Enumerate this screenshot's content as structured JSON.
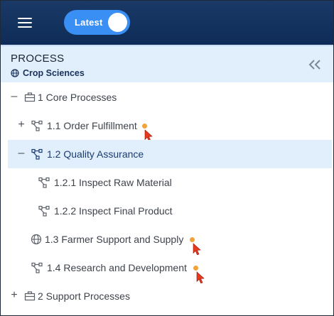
{
  "toolbar": {
    "menu_icon": "hamburger-menu-icon",
    "toggle_label": "Latest",
    "toggle_state": "on"
  },
  "panel": {
    "title": "PROCESS",
    "subtitle": "Crop Sciences",
    "subtitle_icon": "globe-icon",
    "collapse_icon": "double-chevron-left-icon"
  },
  "tree": {
    "items": [
      {
        "label": "1 Core Processes",
        "expander": "–",
        "icon": "briefcase-icon"
      },
      {
        "label": "1.1 Order Fulfillment",
        "expander": "+",
        "icon": "process-flow-icon",
        "indicator": true
      },
      {
        "label": "1.2 Quality Assurance",
        "expander": "–",
        "icon": "process-flow-icon",
        "selected": true
      },
      {
        "label": "1.2.1 Inspect Raw Material",
        "expander": "",
        "icon": "process-flow-icon"
      },
      {
        "label": "1.2.2 Inspect Final Product",
        "expander": "",
        "icon": "process-flow-icon"
      },
      {
        "label": "1.3 Farmer Support and Supply",
        "expander": "",
        "icon": "globe-icon",
        "indicator": true
      },
      {
        "label": "1.4 Research and Development",
        "expander": "",
        "icon": "process-flow-icon",
        "indicator": true
      },
      {
        "label": "2 Support Processes",
        "expander": "+",
        "icon": "briefcase-icon"
      }
    ]
  },
  "colors": {
    "topbar": "#0e2c57",
    "toggle": "#3a8ff5",
    "panel_header": "#e1eefb",
    "selected_row": "#e1eefb",
    "indicator_dot": "#f0a33b",
    "pointer": "#e8381d"
  }
}
